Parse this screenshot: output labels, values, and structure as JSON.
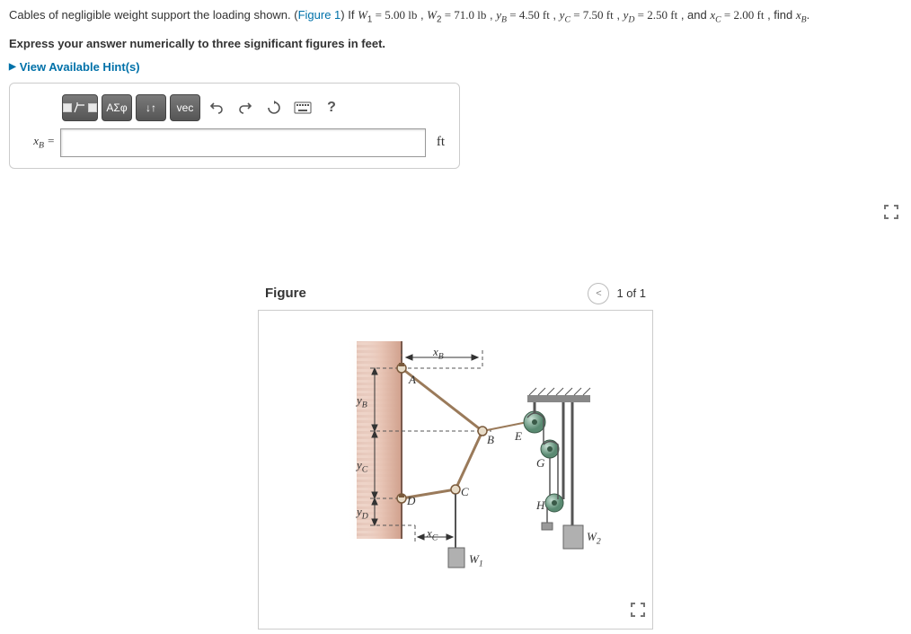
{
  "problem": {
    "intro": "Cables of negligible weight support the loading shown. (",
    "figure_link": "Figure 1",
    "after_link": ") If ",
    "vars": {
      "W1_name": "W",
      "W1_sub": "1",
      "W1_eq": " = 5.00 ",
      "W1_unit": "lb",
      "W2_name": "W",
      "W2_sub": "2",
      "W2_eq": " = 71.0 ",
      "W2_unit": "lb",
      "yB_name": "y",
      "yB_sub": "B",
      "yB_eq": " = 4.50 ",
      "yB_unit": "ft",
      "yC_name": "y",
      "yC_sub": "C",
      "yC_eq": " = 7.50 ",
      "yC_unit": "ft",
      "yD_name": "y",
      "yD_sub": "D",
      "yD_eq": " = 2.50 ",
      "yD_unit": "ft",
      "xC_name": "x",
      "xC_sub": "C",
      "xC_eq": " = 2.00 ",
      "xC_unit": "ft",
      "tail": " , find ",
      "find_name": "x",
      "find_sub": "B",
      "find_tail": "."
    },
    "sep": " , ",
    "and": " , and ",
    "instruction": "Express your answer numerically to three significant figures in feet.",
    "hints_label": "View Available Hint(s)"
  },
  "toolbar": {
    "greek": "ΑΣφ",
    "updown": "↓↑",
    "vec": "vec",
    "help": "?"
  },
  "answer": {
    "label_var": "x",
    "label_sub": "B",
    "label_eq": " =",
    "unit": "ft"
  },
  "figure": {
    "title": "Figure",
    "pager": "1 of 1",
    "labels": {
      "A": "A",
      "B": "B",
      "C": "C",
      "D": "D",
      "E": "E",
      "G": "G",
      "H": "H",
      "xB": "x",
      "xB_sub": "B",
      "xC": "x",
      "xC_sub": "C",
      "yB": "y",
      "yB_sub": "B",
      "yC": "y",
      "yC_sub": "C",
      "yD": "y",
      "yD_sub": "D",
      "W1": "W",
      "W1_sub": "1",
      "W2": "W",
      "W2_sub": "2"
    }
  }
}
